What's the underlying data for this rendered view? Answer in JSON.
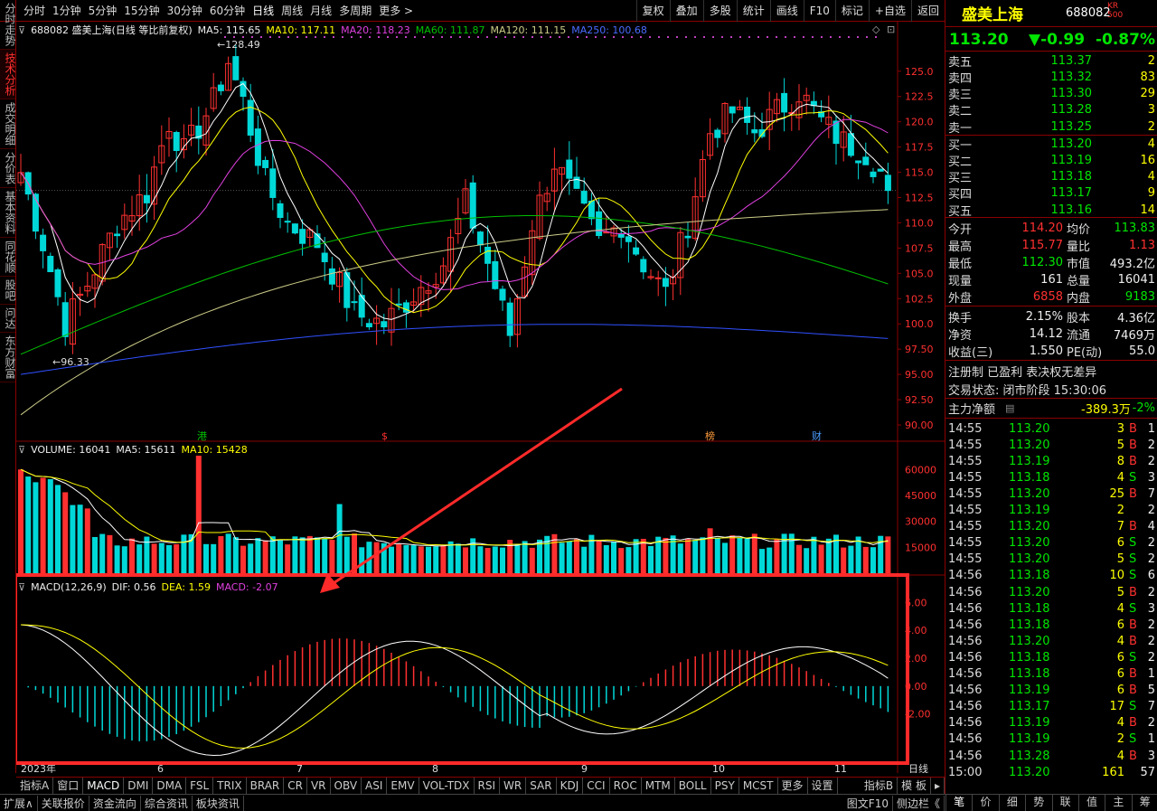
{
  "toolbar": {
    "periods": [
      "分时",
      "1分钟",
      "5分钟",
      "15分钟",
      "30分钟",
      "60分钟",
      "日线",
      "周线",
      "月线",
      "多周期",
      "更多 >"
    ],
    "active_period": "日线",
    "tools": [
      "复权",
      "叠加",
      "多股",
      "统计",
      "画线",
      "F10",
      "标记",
      "+自选",
      "返回"
    ]
  },
  "left_tabs": [
    "分时走势",
    "技术分析",
    "成交明细",
    "分价表",
    "基本资料",
    "同花顺",
    "股吧",
    "问达",
    "东方财富"
  ],
  "left_tab_active": "技术分析",
  "price_info": {
    "code_name": "688082 盛美上海(日线 等比前复权)",
    "ma5": "MA5: 115.65",
    "ma10": "MA10: 117.11",
    "ma20": "MA20: 118.23",
    "ma60": "MA60: 111.87",
    "ma120": "MA120: 111.15",
    "ma250": "MA250: 100.68",
    "high_mark": "128.49",
    "low_mark": "96.33",
    "axis": [
      "125.0",
      "122.5",
      "120.0",
      "117.5",
      "115.0",
      "112.5",
      "110.0",
      "107.5",
      "105.0",
      "102.5",
      "100.0",
      "97.50",
      "95.00",
      "92.50",
      "90.00"
    ],
    "event_markers": [
      "港",
      "$",
      "榜",
      "财"
    ]
  },
  "volume_info": {
    "label": "VOLUME: 16041",
    "ma5": "MA5: 15611",
    "ma10": "MA10: 15428",
    "axis": [
      "60000",
      "45000",
      "30000",
      "15000"
    ]
  },
  "macd_info": {
    "label": "MACD(12,26,9)",
    "dif": "DIF: 0.56",
    "dea": "DEA: 1.59",
    "macd": "MACD: -2.07",
    "axis": [
      "6.00",
      "4.00",
      "2.00",
      "0.00",
      "-2.00"
    ]
  },
  "x_axis": {
    "year": "2023年",
    "months": [
      "6",
      "7",
      "8",
      "9",
      "10",
      "11"
    ],
    "unit": "日线"
  },
  "bottom_tabs": [
    "指标A",
    "窗口",
    "MACD",
    "DMI",
    "DMA",
    "FSL",
    "TRIX",
    "BRAR",
    "CR",
    "VR",
    "OBV",
    "ASI",
    "EMV",
    "VOL-TDX",
    "RSI",
    "WR",
    "SAR",
    "KDJ",
    "CCI",
    "ROC",
    "MTM",
    "BOLL",
    "PSY",
    "MCST",
    "更多",
    "设置"
  ],
  "bottom_tabs_right": [
    "指标B",
    "模 板"
  ],
  "status_bar": [
    "扩展∧",
    "关联报价",
    "资金流向",
    "综合资讯",
    "板块资讯"
  ],
  "status_right": [
    "图文F10",
    "侧边栏《"
  ],
  "stock": {
    "name": "盛美上海",
    "code": "688082",
    "badge_top": "KR",
    "badge_bottom": "500",
    "price": "113.20",
    "change": "▼-0.99",
    "pct": "-0.87%"
  },
  "asks": [
    {
      "label": "卖五",
      "price": "113.37",
      "vol": "2"
    },
    {
      "label": "卖四",
      "price": "113.32",
      "vol": "83"
    },
    {
      "label": "卖三",
      "price": "113.30",
      "vol": "29"
    },
    {
      "label": "卖二",
      "price": "113.28",
      "vol": "3"
    },
    {
      "label": "卖一",
      "price": "113.25",
      "vol": "2"
    }
  ],
  "bids": [
    {
      "label": "买一",
      "price": "113.20",
      "vol": "4"
    },
    {
      "label": "买二",
      "price": "113.19",
      "vol": "16"
    },
    {
      "label": "买三",
      "price": "113.18",
      "vol": "4"
    },
    {
      "label": "买四",
      "price": "113.17",
      "vol": "9"
    },
    {
      "label": "买五",
      "price": "113.16",
      "vol": "14"
    }
  ],
  "stats": [
    {
      "l1": "今开",
      "v1": "114.20",
      "c1": "red",
      "l2": "均价",
      "v2": "113.83",
      "c2": "green"
    },
    {
      "l1": "最高",
      "v1": "115.77",
      "c1": "red",
      "l2": "量比",
      "v2": "1.13",
      "c2": "red"
    },
    {
      "l1": "最低",
      "v1": "112.30",
      "c1": "green",
      "l2": "市值",
      "v2": "493.2亿",
      "c2": "white"
    },
    {
      "l1": "现量",
      "v1": "161",
      "c1": "white",
      "l2": "总量",
      "v2": "16041",
      "c2": "white"
    },
    {
      "l1": "外盘",
      "v1": "6858",
      "c1": "red",
      "l2": "内盘",
      "v2": "9183",
      "c2": "green"
    }
  ],
  "fund": [
    {
      "l1": "换手",
      "v1": "2.15%",
      "l2": "股本",
      "v2": "4.36亿"
    },
    {
      "l1": "净资",
      "v1": "14.12",
      "l2": "流通",
      "v2": "7469万"
    },
    {
      "l1": "收益(三)",
      "v1": "1.550",
      "l2": "PE(动)",
      "v2": "55.0"
    }
  ],
  "reg_text": "注册制 已盈利 表决权无差异",
  "trade_status": "交易状态: 闭市阶段 15:30:06",
  "main_flow": {
    "label": "主力净额",
    "value": "-389.3万",
    "pct": "-2%"
  },
  "ticks": [
    {
      "t": "14:55",
      "p": "113.20",
      "v": "3",
      "d": "B",
      "n": "1"
    },
    {
      "t": "14:55",
      "p": "113.20",
      "v": "5",
      "d": "B",
      "n": "2"
    },
    {
      "t": "14:55",
      "p": "113.19",
      "v": "8",
      "d": "B",
      "n": "2"
    },
    {
      "t": "14:55",
      "p": "113.18",
      "v": "4",
      "d": "S",
      "n": "3"
    },
    {
      "t": "14:55",
      "p": "113.20",
      "v": "25",
      "d": "B",
      "n": "7"
    },
    {
      "t": "14:55",
      "p": "113.19",
      "v": "2",
      "d": "",
      "n": "2"
    },
    {
      "t": "14:55",
      "p": "113.20",
      "v": "7",
      "d": "B",
      "n": "4"
    },
    {
      "t": "14:55",
      "p": "113.20",
      "v": "6",
      "d": "S",
      "n": "2"
    },
    {
      "t": "14:55",
      "p": "113.20",
      "v": "5",
      "d": "S",
      "n": "2"
    },
    {
      "t": "14:56",
      "p": "113.18",
      "v": "10",
      "d": "S",
      "n": "6"
    },
    {
      "t": "14:56",
      "p": "113.20",
      "v": "5",
      "d": "B",
      "n": "2"
    },
    {
      "t": "14:56",
      "p": "113.18",
      "v": "4",
      "d": "S",
      "n": "3"
    },
    {
      "t": "14:56",
      "p": "113.18",
      "v": "6",
      "d": "B",
      "n": "2"
    },
    {
      "t": "14:56",
      "p": "113.20",
      "v": "4",
      "d": "B",
      "n": "2"
    },
    {
      "t": "14:56",
      "p": "113.18",
      "v": "6",
      "d": "S",
      "n": "2"
    },
    {
      "t": "14:56",
      "p": "113.18",
      "v": "6",
      "d": "B",
      "n": "1"
    },
    {
      "t": "14:56",
      "p": "113.19",
      "v": "6",
      "d": "B",
      "n": "5"
    },
    {
      "t": "14:56",
      "p": "113.17",
      "v": "17",
      "d": "S",
      "n": "7"
    },
    {
      "t": "14:56",
      "p": "113.19",
      "v": "4",
      "d": "B",
      "n": "2"
    },
    {
      "t": "14:56",
      "p": "113.19",
      "v": "2",
      "d": "S",
      "n": "1"
    },
    {
      "t": "14:56",
      "p": "113.28",
      "v": "4",
      "d": "B",
      "n": "3"
    },
    {
      "t": "15:00",
      "p": "113.20",
      "v": "161",
      "d": "",
      "n": "57"
    }
  ],
  "panel_tabs": [
    "笔",
    "价",
    "细",
    "势",
    "联",
    "值",
    "主",
    "筹"
  ],
  "colors": {
    "up": "#ff3030",
    "down": "#00d8d8",
    "ma5": "#ffffff",
    "ma10": "#ffff00",
    "ma20": "#e040e0",
    "ma60": "#00c000",
    "ma120": "#cccc88",
    "ma250": "#3050ff",
    "highlight": "#ff2a2a"
  }
}
